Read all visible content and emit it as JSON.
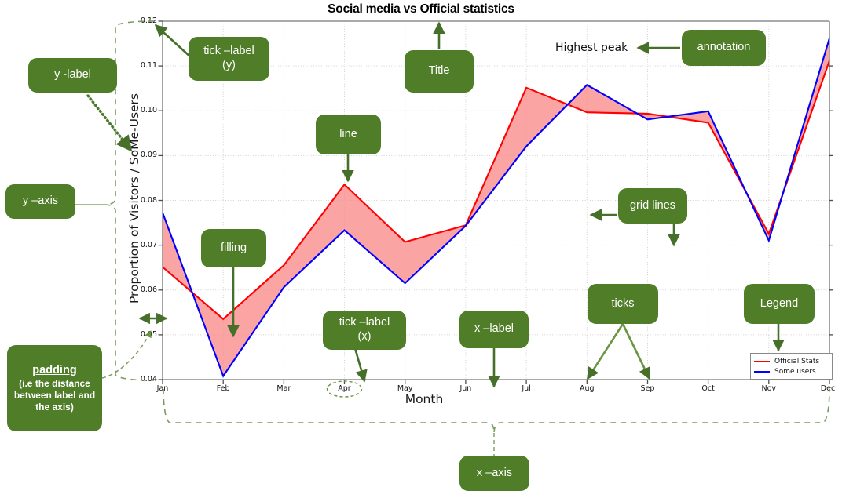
{
  "chart_data": {
    "type": "line",
    "title": "Social media vs Official statistics",
    "xlabel": "Month",
    "ylabel": "Proportion of Visitors / SoMe-Users",
    "categories": [
      "Jan",
      "Feb",
      "Mar",
      "Apr",
      "May",
      "Jun",
      "Jul",
      "Aug",
      "Sep",
      "Oct",
      "Nov",
      "Dec"
    ],
    "ylim": [
      0.04,
      0.12
    ],
    "yticks": [
      "0.04",
      "0.05",
      "0.06",
      "0.07",
      "0.08",
      "0.09",
      "0.10",
      "0.11",
      "0.12"
    ],
    "ytick_values": [
      0.04,
      0.05,
      0.06,
      0.07,
      0.08,
      0.09,
      0.1,
      0.11,
      0.12
    ],
    "grid": true,
    "legend_position": "lower right",
    "fill_between": true,
    "fill_color": "#fa8a8a",
    "series": [
      {
        "name": "Official Stats",
        "color": "#ff0000",
        "values": [
          0.0653,
          0.0537,
          0.0657,
          0.0837,
          0.0709,
          0.0746,
          0.1053,
          0.0998,
          0.0995,
          0.0975,
          0.0727,
          0.1113
        ]
      },
      {
        "name": "Some users",
        "color": "#0000ff",
        "values": [
          0.0762,
          0.0409,
          0.0607,
          0.0735,
          0.0617,
          0.0745,
          0.0985,
          0.1122,
          0.1045,
          0.1063,
          0.0712,
          0.1163
        ]
      }
    ],
    "annotations": [
      {
        "text": "Highest peak",
        "x": "Aug"
      }
    ]
  },
  "legend": {
    "entries": [
      {
        "label": "Official Stats",
        "color": "#ff0000"
      },
      {
        "label": "Some users",
        "color": "#0000ff"
      }
    ]
  },
  "callouts": {
    "y_label": "y -label",
    "y_axis": "y –axis",
    "padding_title": "padding",
    "padding_sub": "(i.e the distance between label and the axis)",
    "tick_label_y_line1": "tick –label",
    "tick_label_y_line2": "(y)",
    "title": "Title",
    "line": "line",
    "filling": "filling",
    "tick_label_x_line1": "tick –label",
    "tick_label_x_line2": "(x)",
    "x_label": "x –label",
    "x_axis": "x –axis",
    "annotation": "annotation",
    "grid_lines": "grid lines",
    "ticks": "ticks",
    "legend": "Legend"
  },
  "colors": {
    "callout_green": "#4f7d28",
    "arrow_green": "#46702a",
    "dash_green": "#7a9a5e",
    "official": "#ff0000",
    "someusers": "#0000ff",
    "fill": "#fa8a8a"
  }
}
